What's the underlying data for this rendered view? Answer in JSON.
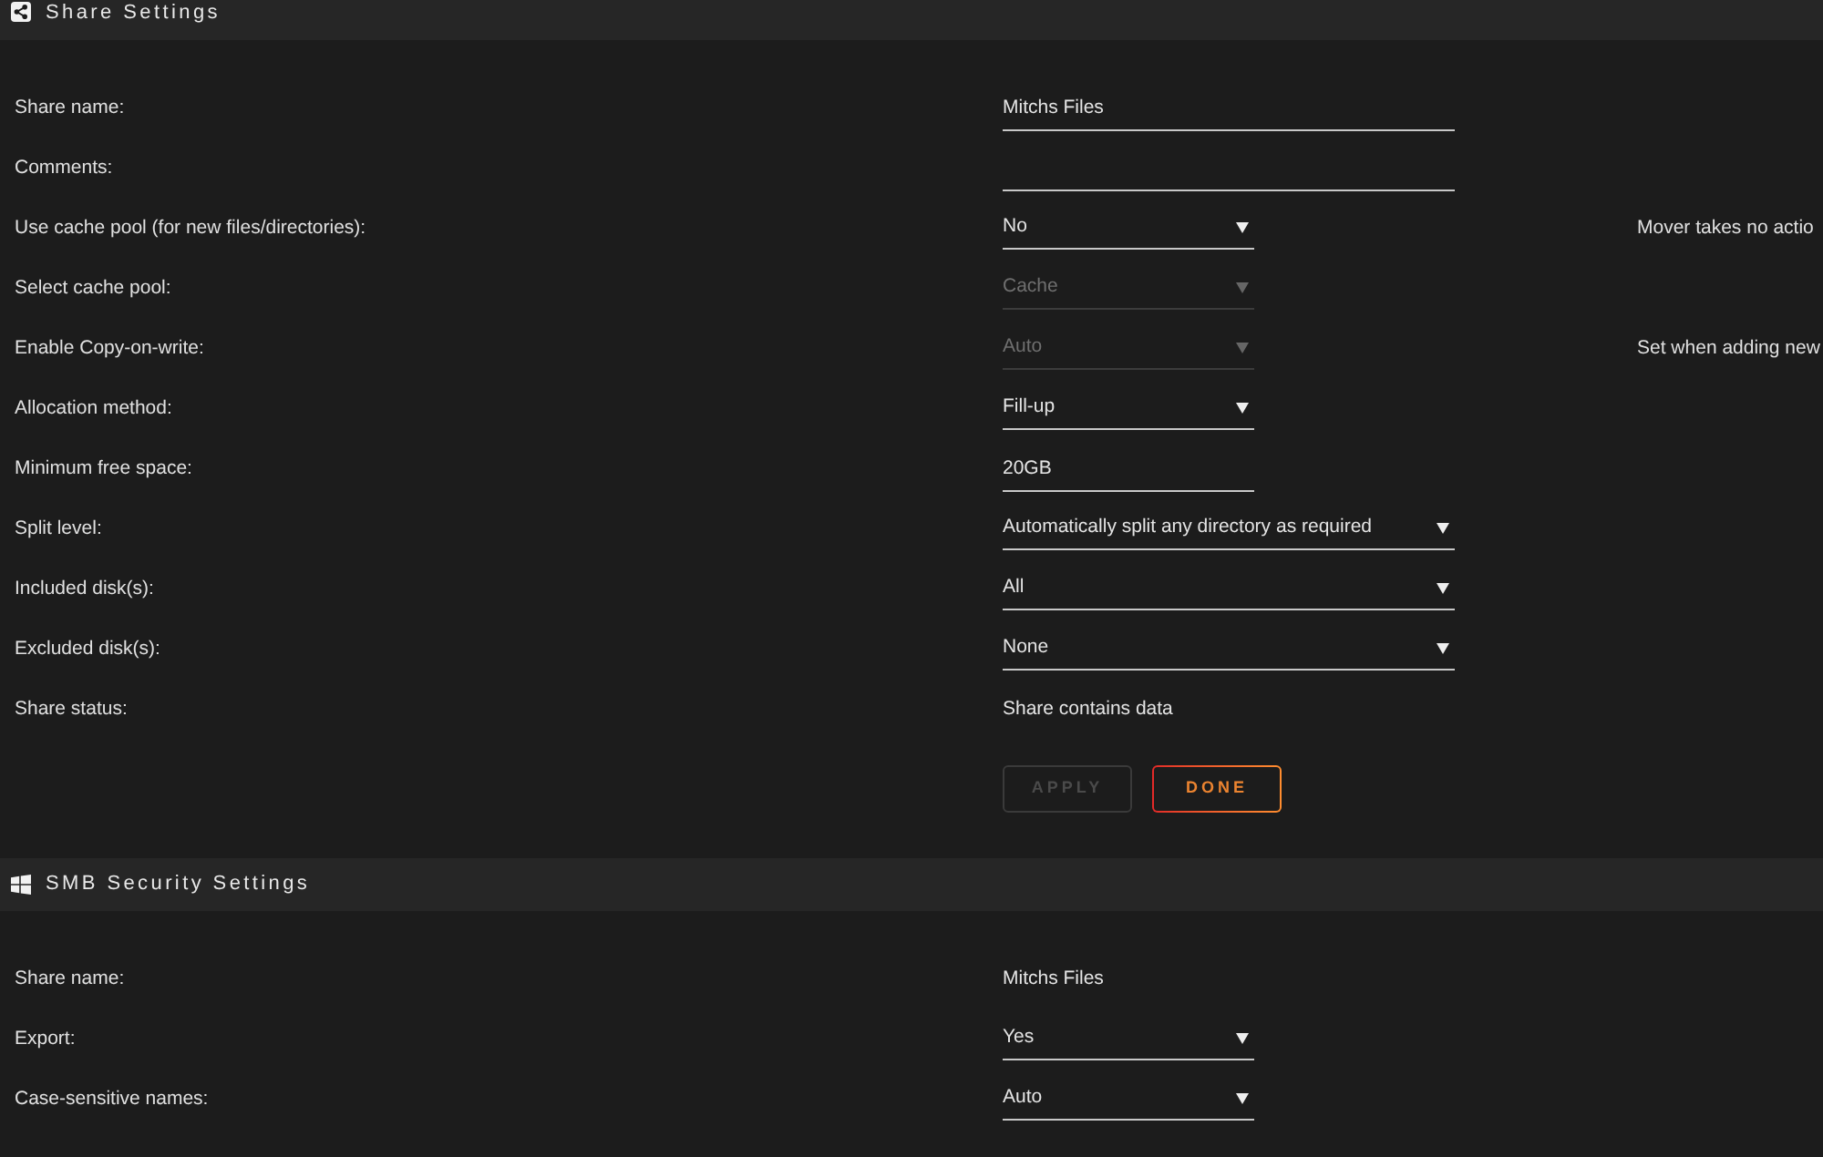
{
  "sections": [
    {
      "kind": "share",
      "title": "Share Settings",
      "fields": [
        {
          "label": "Share name:",
          "kind": "text",
          "value": "Mitchs Files",
          "disabled": false
        },
        {
          "label": "Comments:",
          "kind": "text",
          "disabled": false
        },
        {
          "label": "Use cache pool (for new files/directories):",
          "kind": "select",
          "value": "No",
          "disabled": false,
          "note": "Mover takes no actio"
        },
        {
          "label": "Select cache pool:",
          "kind": "select",
          "value": "Cache",
          "disabled": true
        },
        {
          "label": "Enable Copy-on-write:",
          "kind": "select",
          "value": "Auto",
          "disabled": true,
          "note": "Set when adding new"
        },
        {
          "label": "Allocation method:",
          "kind": "select",
          "value": "Fill-up",
          "disabled": false
        },
        {
          "label": "Minimum free space:",
          "kind": "text",
          "value": "20GB",
          "disabled": false
        },
        {
          "label": "Split level:",
          "kind": "select",
          "value": "Automatically split any directory as required",
          "disabled": false
        },
        {
          "label": "Included disk(s):",
          "kind": "select",
          "value": "All",
          "disabled": false
        },
        {
          "label": "Excluded disk(s):",
          "kind": "select",
          "value": "None",
          "disabled": false
        },
        {
          "label": "Share status:",
          "kind": "static",
          "value": "Share contains data",
          "disabled": false
        }
      ],
      "buttons": [
        {
          "label": "APPLY",
          "disabled": true
        },
        {
          "label": "DONE",
          "disabled": false
        }
      ]
    },
    {
      "kind": "smb",
      "title": "SMB Security Settings",
      "fields": [
        {
          "label": "Share name:",
          "kind": "static",
          "value": "Mitchs Files",
          "disabled": false
        },
        {
          "label": "Export:",
          "kind": "select",
          "value": "Yes",
          "disabled": false
        },
        {
          "label": "Case-sensitive names:",
          "kind": "select",
          "value": "Auto",
          "disabled": false
        }
      ]
    }
  ]
}
